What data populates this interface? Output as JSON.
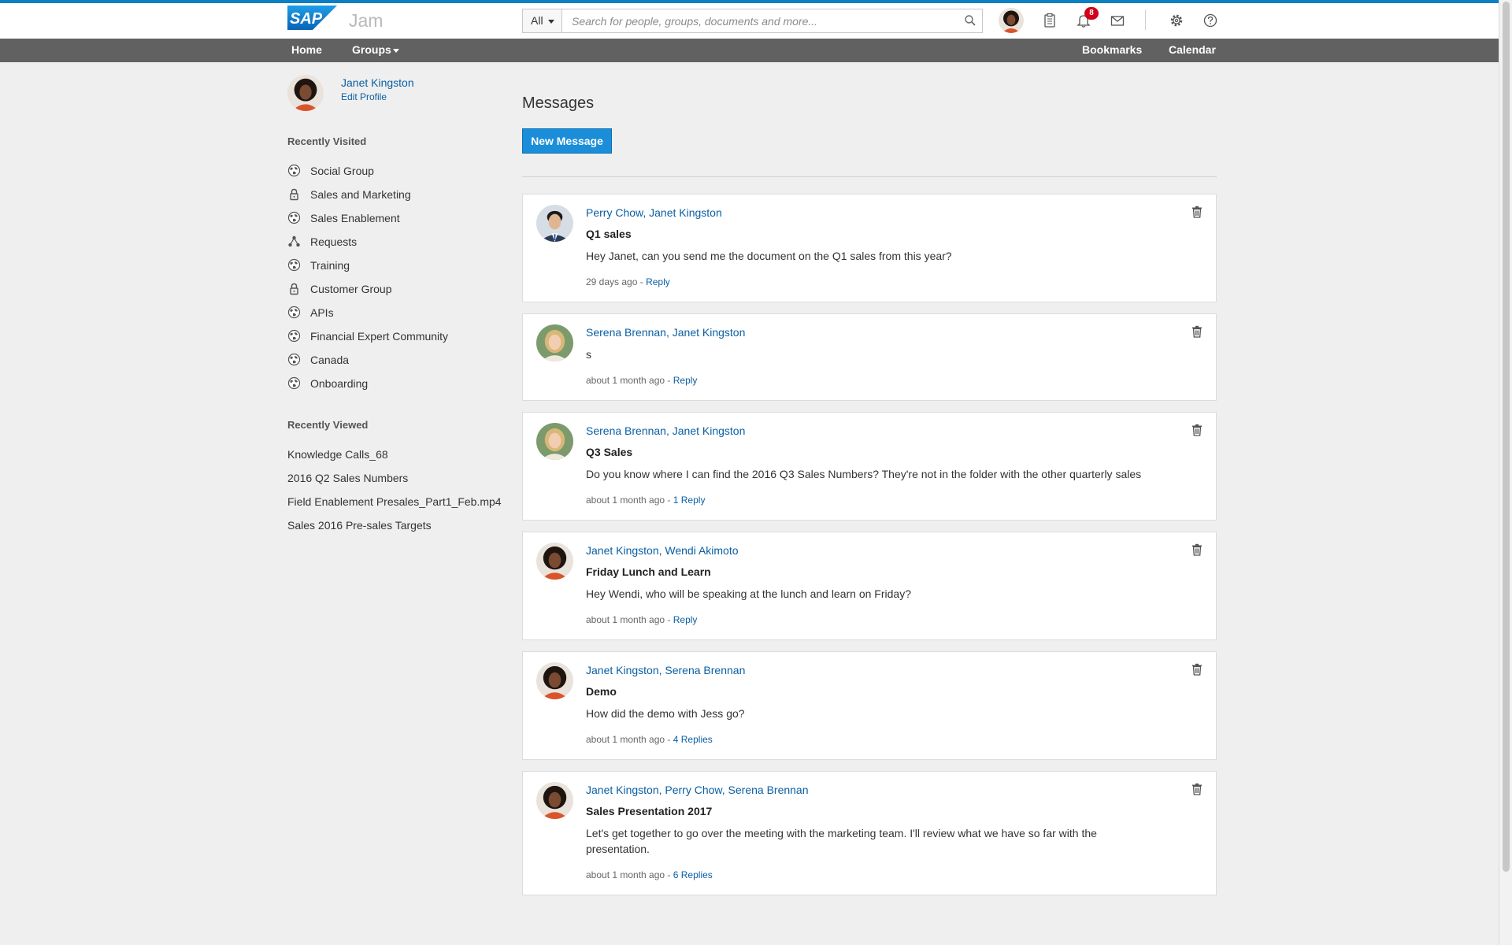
{
  "header": {
    "brand": "SAP",
    "product": "Jam",
    "search_scope": "All",
    "search_placeholder": "Search for people, groups, documents and more...",
    "notification_count": "8",
    "accent_color": "#0a7fc2"
  },
  "nav": {
    "home": "Home",
    "groups": "Groups",
    "bookmarks": "Bookmarks",
    "calendar": "Calendar"
  },
  "profile": {
    "name": "Janet Kingston",
    "edit_label": "Edit Profile"
  },
  "sidebar": {
    "recently_visited_title": "Recently Visited",
    "recently_visited": [
      {
        "label": "Social Group",
        "icon": "globe-icon"
      },
      {
        "label": "Sales and Marketing",
        "icon": "lock-icon"
      },
      {
        "label": "Sales Enablement",
        "icon": "globe-icon"
      },
      {
        "label": "Requests",
        "icon": "network-icon"
      },
      {
        "label": "Training",
        "icon": "globe-icon"
      },
      {
        "label": "Customer Group",
        "icon": "lock-icon"
      },
      {
        "label": "APIs",
        "icon": "globe-icon"
      },
      {
        "label": "Financial Expert Community",
        "icon": "globe-icon"
      },
      {
        "label": "Canada",
        "icon": "globe-icon"
      },
      {
        "label": "Onboarding",
        "icon": "globe-icon"
      }
    ],
    "recently_viewed_title": "Recently Viewed",
    "recently_viewed": [
      "Knowledge Calls_68",
      "2016 Q2 Sales Numbers",
      "Field Enablement Presales_Part1_Feb.mp4",
      "Sales 2016 Pre-sales Targets"
    ]
  },
  "main": {
    "title": "Messages",
    "new_message_label": "New Message",
    "messages": [
      {
        "participants": "Perry Chow, Janet Kingston",
        "avatar": "perry",
        "subject": "Q1 sales",
        "snippet": "Hey Janet, can you send me the document on the Q1 sales from this year?",
        "time": "29 days ago",
        "separator": " - ",
        "reply": "Reply"
      },
      {
        "participants": "Serena Brennan, Janet Kingston",
        "avatar": "serena",
        "subject": "",
        "snippet": "s",
        "time": "about 1 month ago",
        "separator": " - ",
        "reply": "Reply"
      },
      {
        "participants": "Serena Brennan, Janet Kingston",
        "avatar": "serena",
        "subject": "Q3 Sales",
        "snippet": "Do you know where I can find the 2016 Q3 Sales Numbers? They're not in the folder with the other quarterly sales",
        "time": "about 1 month ago",
        "separator": " - ",
        "reply": "1 Reply"
      },
      {
        "participants": "Janet Kingston, Wendi Akimoto",
        "avatar": "janet",
        "subject": "Friday Lunch and Learn",
        "snippet": "Hey Wendi, who will be speaking at the lunch and learn on Friday?",
        "time": "about 1 month ago",
        "separator": " - ",
        "reply": "Reply"
      },
      {
        "participants": "Janet Kingston, Serena Brennan",
        "avatar": "janet",
        "subject": "Demo",
        "snippet": "How did the demo with Jess go?",
        "time": "about 1 month ago",
        "separator": " - ",
        "reply": "4 Replies"
      },
      {
        "participants": "Janet Kingston, Perry Chow, Serena Brennan",
        "avatar": "janet",
        "subject": "Sales Presentation 2017",
        "snippet": "Let's get together to go over the meeting with the marketing team. I'll review what we have so far with the presentation.",
        "time": "about 1 month ago",
        "separator": " - ",
        "reply": "6 Replies"
      }
    ]
  }
}
